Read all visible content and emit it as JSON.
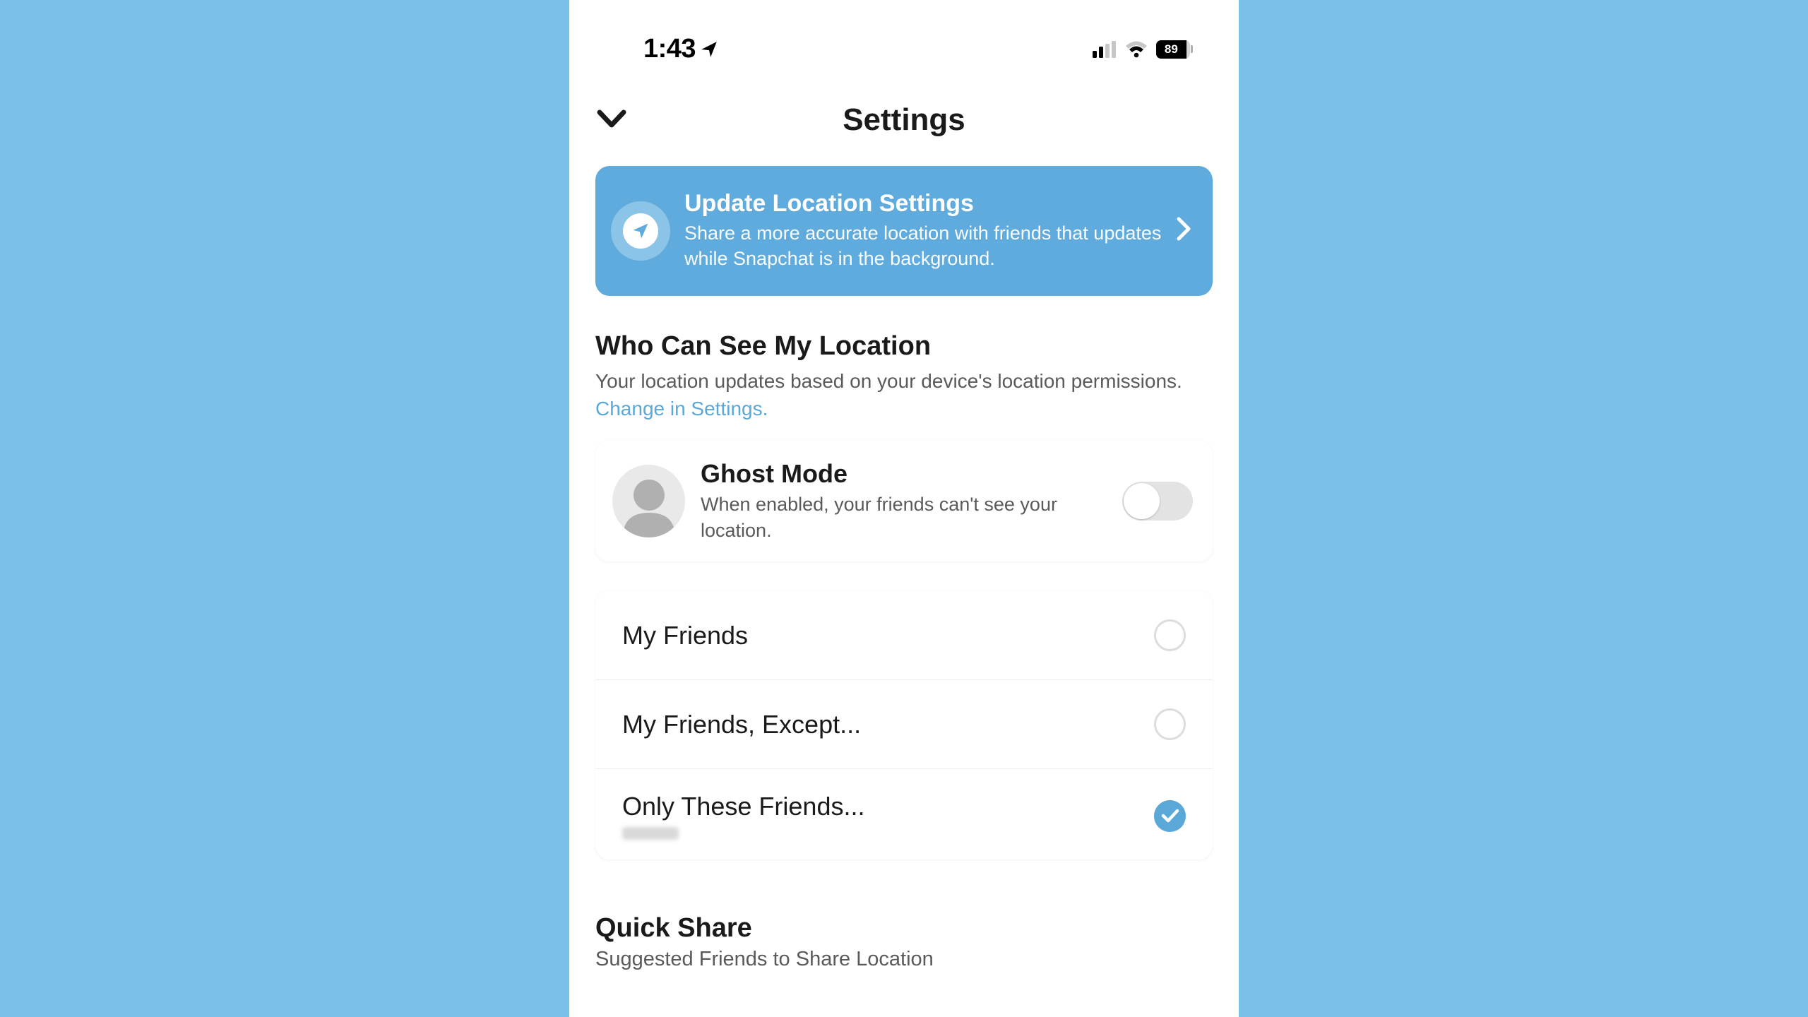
{
  "status": {
    "time": "1:43",
    "battery": "89"
  },
  "header": {
    "title": "Settings"
  },
  "banner": {
    "title": "Update Location Settings",
    "description": "Share a more accurate location with friends that updates while Snapchat is in the background."
  },
  "whoCanSee": {
    "title": "Who Can See My Location",
    "description": "Your location updates based on your device's location permissions. ",
    "link": "Change in Settings."
  },
  "ghost": {
    "title": "Ghost Mode",
    "description": "When enabled, your friends can't see your location."
  },
  "options": [
    {
      "label": "My Friends",
      "selected": false
    },
    {
      "label": "My Friends, Except...",
      "selected": false
    },
    {
      "label": "Only These Friends...",
      "selected": true
    }
  ],
  "quickShare": {
    "title": "Quick Share",
    "description": "Suggested Friends to Share Location"
  }
}
